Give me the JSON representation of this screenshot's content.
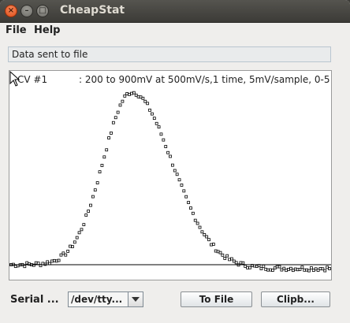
{
  "window": {
    "title": "CheapStat",
    "controls": {
      "close": "×",
      "minimize": "–",
      "maximize": "□"
    }
  },
  "menu": {
    "file": "File",
    "help": "Help"
  },
  "status": {
    "text": "Data sent to file"
  },
  "plot": {
    "title": "CV #1",
    "params": ": 200 to 900mV at 500mV/s,1 time, 5mV/sample, 0-5"
  },
  "bottom": {
    "serial_label": "Serial ...",
    "port_value": "/dev/tty...",
    "to_file_label": "To File",
    "clipboard_label": "Clipb..."
  },
  "chart_data": {
    "type": "scatter",
    "title": "",
    "xlabel": "",
    "ylabel": "",
    "grid": false,
    "baseline": 0,
    "ylim": [
      0,
      1
    ],
    "curve": {
      "x_start": 200,
      "x_end": 900,
      "x_step": 5,
      "peak_x": 465,
      "peak_y": 0.92,
      "rise_width": 88,
      "fall_width": 125,
      "tail_y": -0.02,
      "noise": 0.012
    }
  }
}
